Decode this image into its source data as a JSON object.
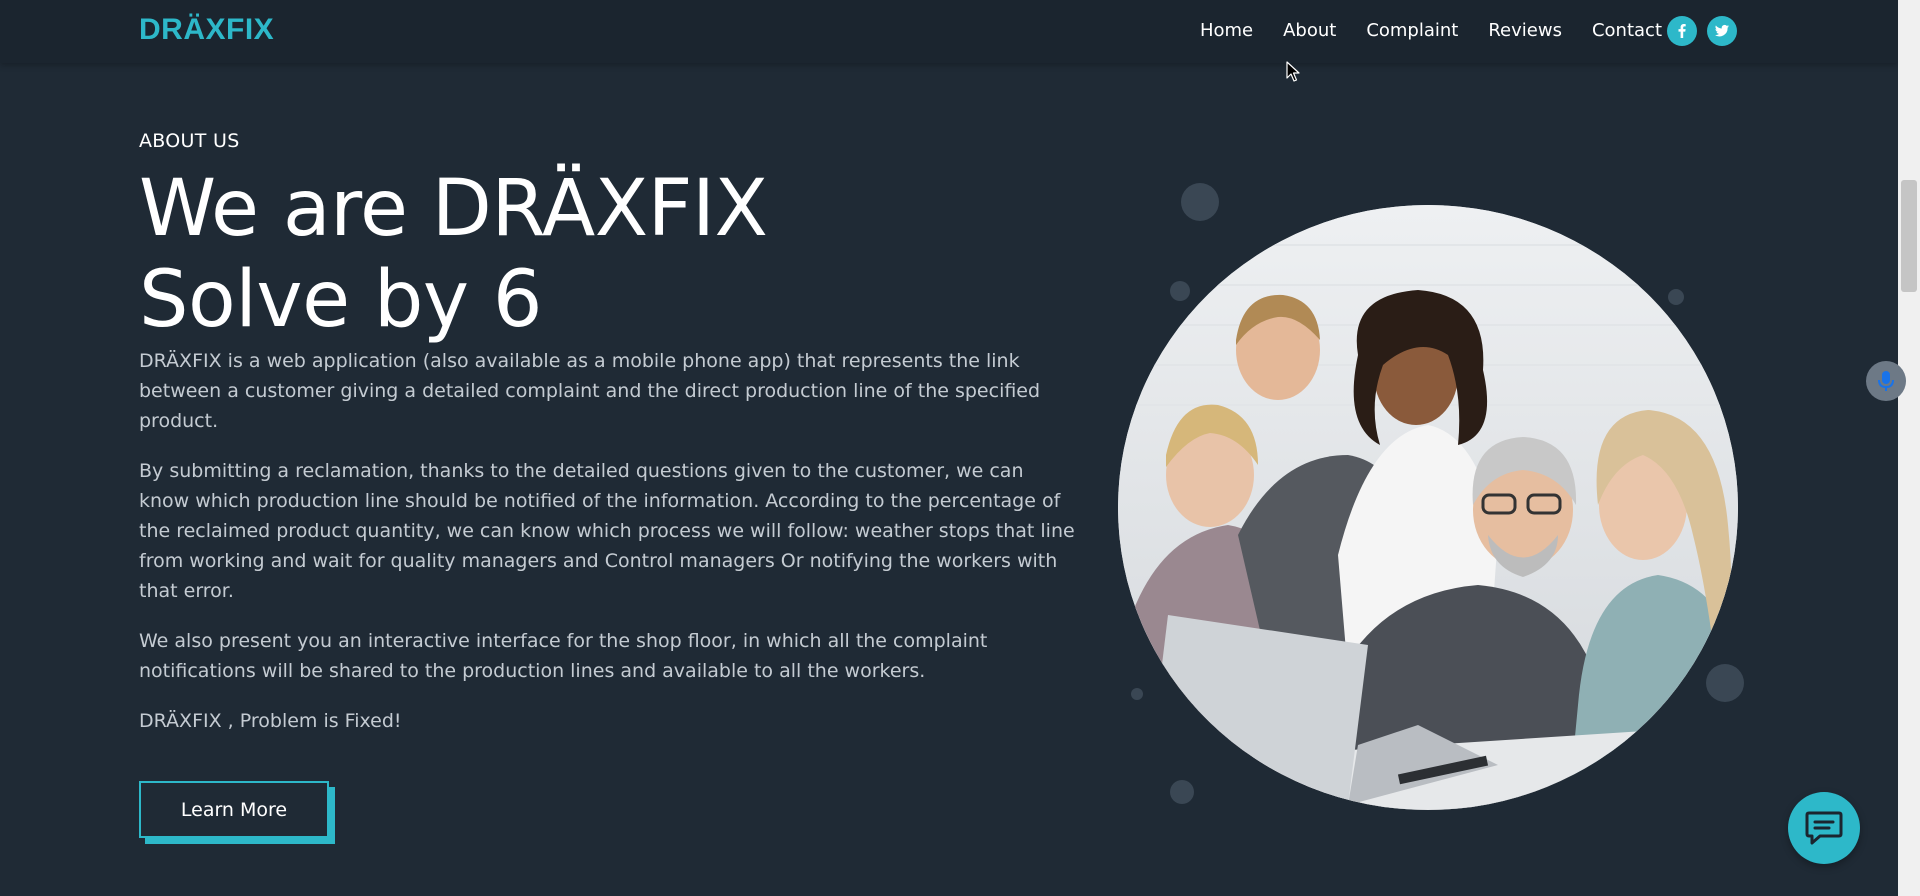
{
  "header": {
    "brand": "DRÄXFIX",
    "nav": [
      "Home",
      "About",
      "Complaint",
      "Reviews",
      "Contact"
    ],
    "social_icons": [
      "facebook-icon",
      "twitter-icon"
    ]
  },
  "about": {
    "eyebrow": "ABOUT US",
    "headline_line1": "We are DRÄXFIX",
    "headline_line2": "Solve by 6",
    "paragraphs": [
      "DRÄXFIX is a web application (also available as a mobile phone app) that represents the link between a customer giving a detailed complaint and the direct production line of the specified product.",
      "By submitting a reclamation, thanks to the detailed questions given to the customer, we can know which production line should be notified of the information. According to the percentage of the reclaimed product quantity, we can know which process we will follow: weather stops that line from working and wait for quality managers and Control managers Or notifying the workers with that error.",
      "We also present you an interactive interface for the shop floor, in which all the complaint notifications will be shared to the production lines and available to all the workers.",
      "DRÄXFIX , Problem is Fixed!"
    ],
    "cta_label": "Learn More"
  },
  "colors": {
    "accent": "#2db8c9",
    "background": "#1f2a35",
    "header_bg": "#1b252f",
    "text_muted": "#c4cbd2"
  },
  "widgets": {
    "chat_icon": "chat-bubble-icon",
    "mic_icon": "microphone-icon"
  }
}
